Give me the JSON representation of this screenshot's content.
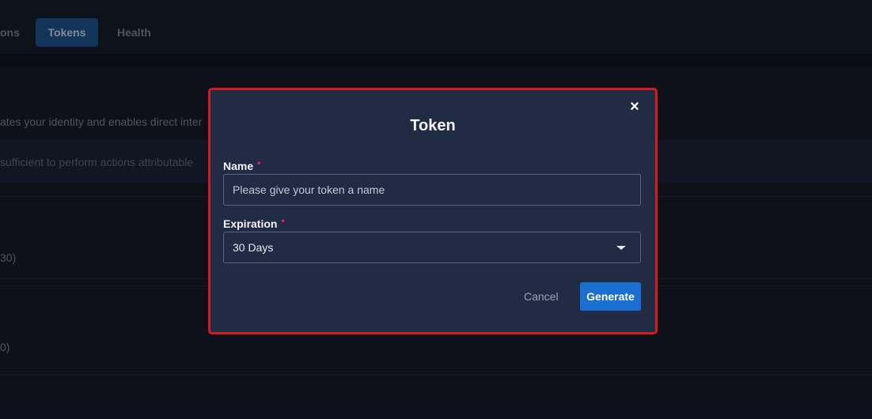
{
  "tabs": [
    {
      "label": "ons"
    },
    {
      "label": "Tokens"
    },
    {
      "label": "Health"
    }
  ],
  "background": {
    "description": "ates your identity and enables direct inter",
    "warning": " sufficient to perform actions attributable",
    "rows": [
      {
        "text": "30)"
      },
      {
        "text": "0)"
      }
    ]
  },
  "modal": {
    "title": "Token",
    "close_icon": "close-icon",
    "name_field": {
      "label": "Name",
      "required_mark": "•",
      "placeholder": "Please give your token a name",
      "value": ""
    },
    "expiration_field": {
      "label": "Expiration",
      "required_mark": "•",
      "selected": "30 Days"
    },
    "cancel_label": "Cancel",
    "generate_label": "Generate"
  },
  "colors": {
    "accent": "#1a6fd1",
    "highlight_border": "#d8181f",
    "required": "#e0245e"
  }
}
